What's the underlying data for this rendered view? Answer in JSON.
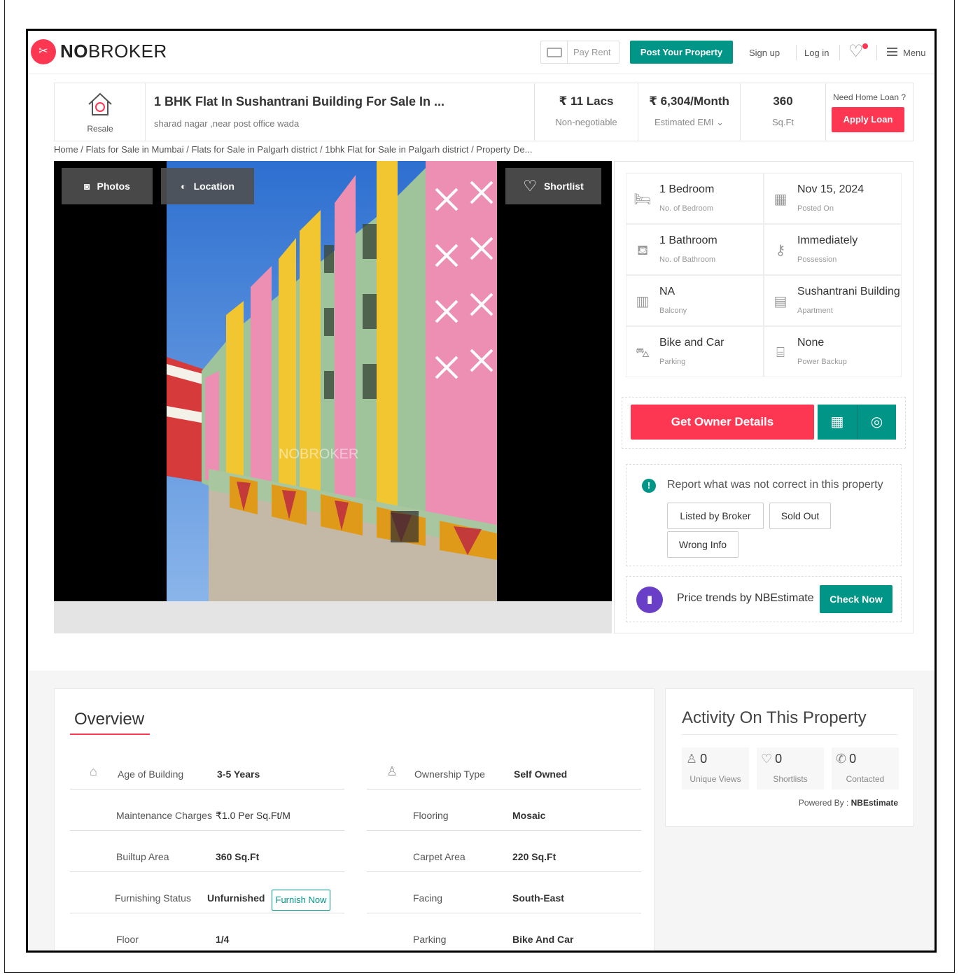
{
  "header": {
    "logo_bold": "NO",
    "logo_rest": "BROKER",
    "pay_rent": "Pay Rent",
    "post_property": "Post Your Property",
    "sign_up": "Sign up",
    "log_in": "Log in",
    "menu": "Menu"
  },
  "summary": {
    "resale_label": "Resale",
    "title": "1 BHK Flat In Sushantrani Building For Sale In ...",
    "address": "sharad nagar ,near post office wada",
    "price": "₹ 11 Lacs",
    "price_note": "Non-negotiable",
    "emi": "₹ 6,304/Month",
    "emi_note": "Estimated EMI",
    "area": "360",
    "area_unit": "Sq.Ft",
    "need_loan": "Need Home Loan ?",
    "apply_loan": "Apply Loan"
  },
  "breadcrumb": "Home / Flats for Sale in Mumbai / Flats for Sale in Palgarh district / 1bhk Flat for Sale in Palgarh district / Property De...",
  "gallery": {
    "photos": "Photos",
    "location": "Location",
    "shortlist": "Shortlist",
    "watermark": "NOBROKER"
  },
  "details": [
    {
      "value": "1 Bedroom",
      "label": "No. of Bedroom",
      "icon": "bed-icon"
    },
    {
      "value": "Nov 15, 2024",
      "label": "Posted On",
      "icon": "calendar-icon"
    },
    {
      "value": "1 Bathroom",
      "label": "No. of Bathroom",
      "icon": "bathtub-icon"
    },
    {
      "value": "Immediately",
      "label": "Possession",
      "icon": "key-icon"
    },
    {
      "value": "NA",
      "label": "Balcony",
      "icon": "balcony-icon"
    },
    {
      "value": "Sushantrani Building",
      "label": "Apartment",
      "icon": "building-icon"
    },
    {
      "value": "Bike and Car",
      "label": "Parking",
      "icon": "car-icon"
    },
    {
      "value": "None",
      "label": "Power Backup",
      "icon": "battery-icon"
    }
  ],
  "actions": {
    "get_owner": "Get Owner Details",
    "report_text": "Report what was not correct in this property",
    "listed_by_broker": "Listed by Broker",
    "sold_out": "Sold Out",
    "wrong_info": "Wrong Info",
    "price_trends": "Price trends by NBEstimate",
    "check_now": "Check Now"
  },
  "overview": {
    "title": "Overview",
    "rows": [
      {
        "l1": "Age of Building",
        "v1": "3-5 Years",
        "l2": "Ownership Type",
        "v2": "Self Owned"
      },
      {
        "l1": "Maintenance Charges",
        "v1": "₹1.0 Per Sq.Ft/M",
        "l2": "Flooring",
        "v2": "Mosaic"
      },
      {
        "l1": "Builtup Area",
        "v1": "360 Sq.Ft",
        "l2": "Carpet Area",
        "v2": "220 Sq.Ft"
      },
      {
        "l1": "Furnishing Status",
        "v1": "Unfurnished",
        "l2": "Facing",
        "v2": "South-East"
      },
      {
        "l1": "Floor",
        "v1": "1/4",
        "l2": "Parking",
        "v2": "Bike And Car"
      }
    ],
    "furnish_now": "Furnish Now"
  },
  "activity": {
    "title": "Activity On This Property",
    "unique_views": "0",
    "unique_views_label": "Unique Views",
    "shortlists": "0",
    "shortlists_label": "Shortlists",
    "contacted": "0",
    "contacted_label": "Contacted",
    "powered_by": "Powered By :",
    "powered_name": "NBEstimate"
  },
  "colors": {
    "brand_red": "#fd3752",
    "teal": "#009587",
    "purple": "#6a3fc8"
  }
}
